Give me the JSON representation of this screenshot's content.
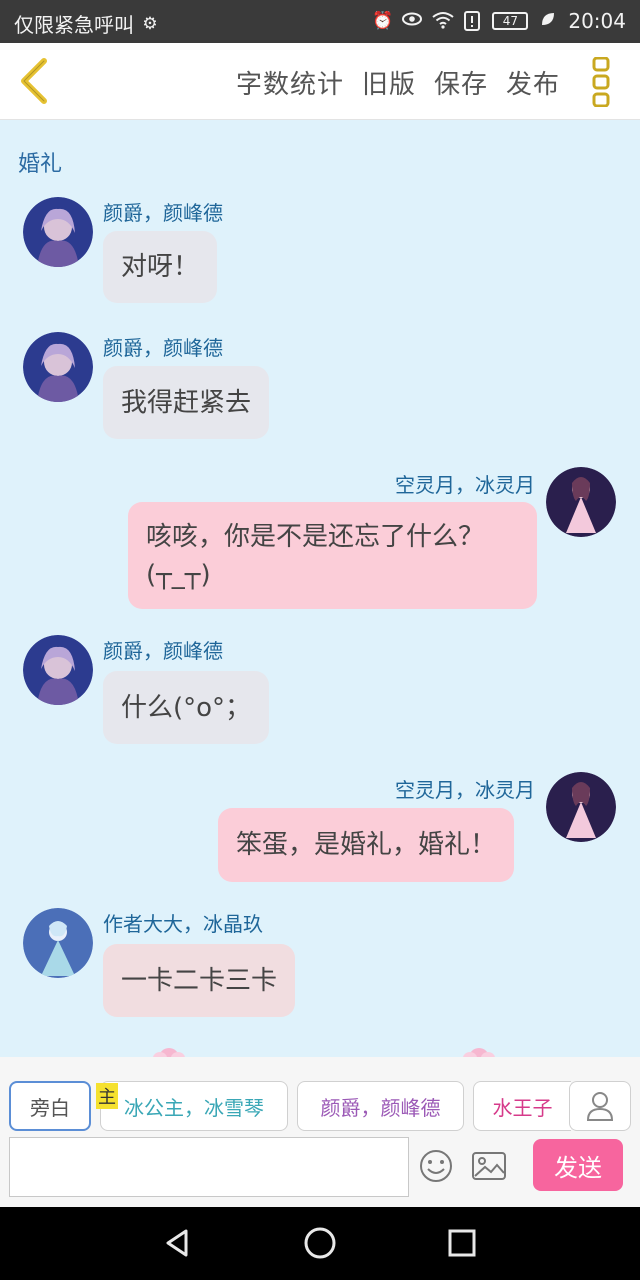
{
  "status_bar": {
    "carrier_text": "仅限紧急呼叫",
    "battery": "47",
    "time": "20:04",
    "icons": [
      "settings-gear-icon",
      "alarm-icon",
      "eye-icon",
      "wifi-icon",
      "sim-alert-icon",
      "battery-icon",
      "leaf-icon"
    ]
  },
  "header": {
    "menu": [
      "字数统计",
      "旧版",
      "保存",
      "发布"
    ],
    "icons": [
      "back-chevron-icon",
      "more-vertical-icon"
    ],
    "accent_color": "#e6c232"
  },
  "chat": {
    "title": "婚礼",
    "messages": [
      {
        "side": "left",
        "name": "颜爵，颜峰德",
        "text": "对呀！",
        "style": "gray"
      },
      {
        "side": "left",
        "name": "颜爵，颜峰德",
        "text": "我得赶紧去",
        "style": "gray"
      },
      {
        "side": "right",
        "name": "空灵月，冰灵月",
        "text_line1": "咳咳，你是不是还忘了什么？",
        "text_line2": "(┬_┬)",
        "style": "pink"
      },
      {
        "side": "left",
        "name": "颜爵，颜峰德",
        "text": "什么(°o°；",
        "style": "gray"
      },
      {
        "side": "right",
        "name": "空灵月，冰灵月",
        "text": "笨蛋，是婚礼，婚礼！",
        "style": "pink"
      },
      {
        "side": "left",
        "name": "作者大大，冰晶玖",
        "text": "一卡二卡三卡",
        "style": "peach"
      }
    ]
  },
  "composer": {
    "chips": [
      {
        "label": "旁白",
        "color": "#555555"
      },
      {
        "label": "冰公主，冰雪琴",
        "color": "#3aa7b6"
      },
      {
        "label": "颜爵，颜峰德",
        "color": "#9b59b6"
      },
      {
        "label": "水王子",
        "color": "#d63a8a"
      }
    ],
    "main_badge": "主",
    "input_value": "",
    "send_label": "发送",
    "icons": [
      "person-icon",
      "emoji-icon",
      "image-icon"
    ]
  },
  "nav": {
    "icons": [
      "nav-back-icon",
      "nav-home-icon",
      "nav-recents-icon"
    ]
  }
}
